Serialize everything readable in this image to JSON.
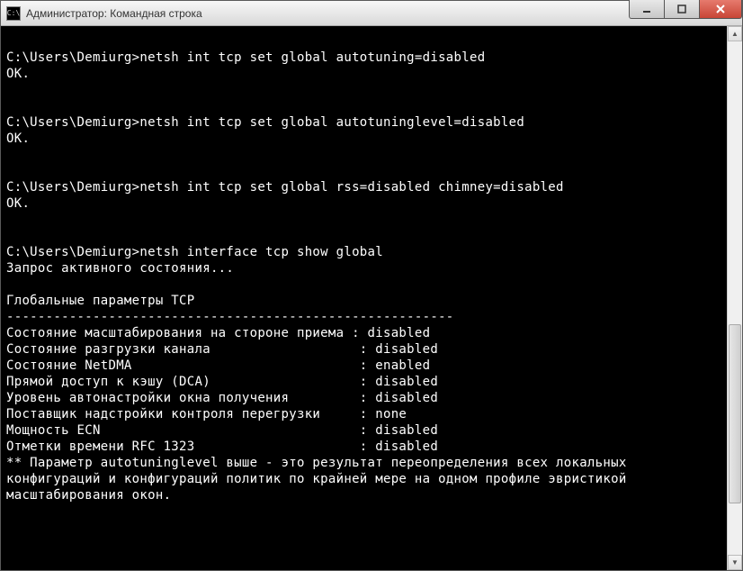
{
  "titlebar": {
    "icon_text": "C:\\",
    "title": "Администратор: Командная строка"
  },
  "prompt": "C:\\Users\\Demiurg>",
  "commands": [
    {
      "cmd": "netsh int tcp set global autotuning=disabled",
      "out": "OK."
    },
    {
      "cmd": "netsh int tcp set global autotuninglevel=disabled",
      "out": "OK."
    },
    {
      "cmd": "netsh int tcp set global rss=disabled chimney=disabled",
      "out": "OK."
    }
  ],
  "show_cmd": "netsh interface tcp show global",
  "query_line": "Запрос активного состояния...",
  "section_header": "Глобальные параметры TCP",
  "divider": "---------------------------------------------------------",
  "params": [
    {
      "label": "Состояние масштабирования на стороне приема ",
      "value": "disabled"
    },
    {
      "label": "Состояние разгрузки канала                   ",
      "value": "disabled"
    },
    {
      "label": "Состояние NetDMA                             ",
      "value": "enabled"
    },
    {
      "label": "Прямой доступ к кэшу (DCA)                   ",
      "value": "disabled"
    },
    {
      "label": "Уровень автонастройки окна получения         ",
      "value": "disabled"
    },
    {
      "label": "Поставщик надстройки контроля перегрузки     ",
      "value": "none"
    },
    {
      "label": "Мощность ECN                                 ",
      "value": "disabled"
    },
    {
      "label": "Отметки времени RFC 1323                     ",
      "value": "disabled"
    }
  ],
  "footer_lines": [
    "** Параметр autotuninglevel выше - это результат переопределения всех локальных",
    "конфигураций и конфигураций политик по крайней мере на одном профиле эвристикой",
    "масштабирования окон."
  ]
}
